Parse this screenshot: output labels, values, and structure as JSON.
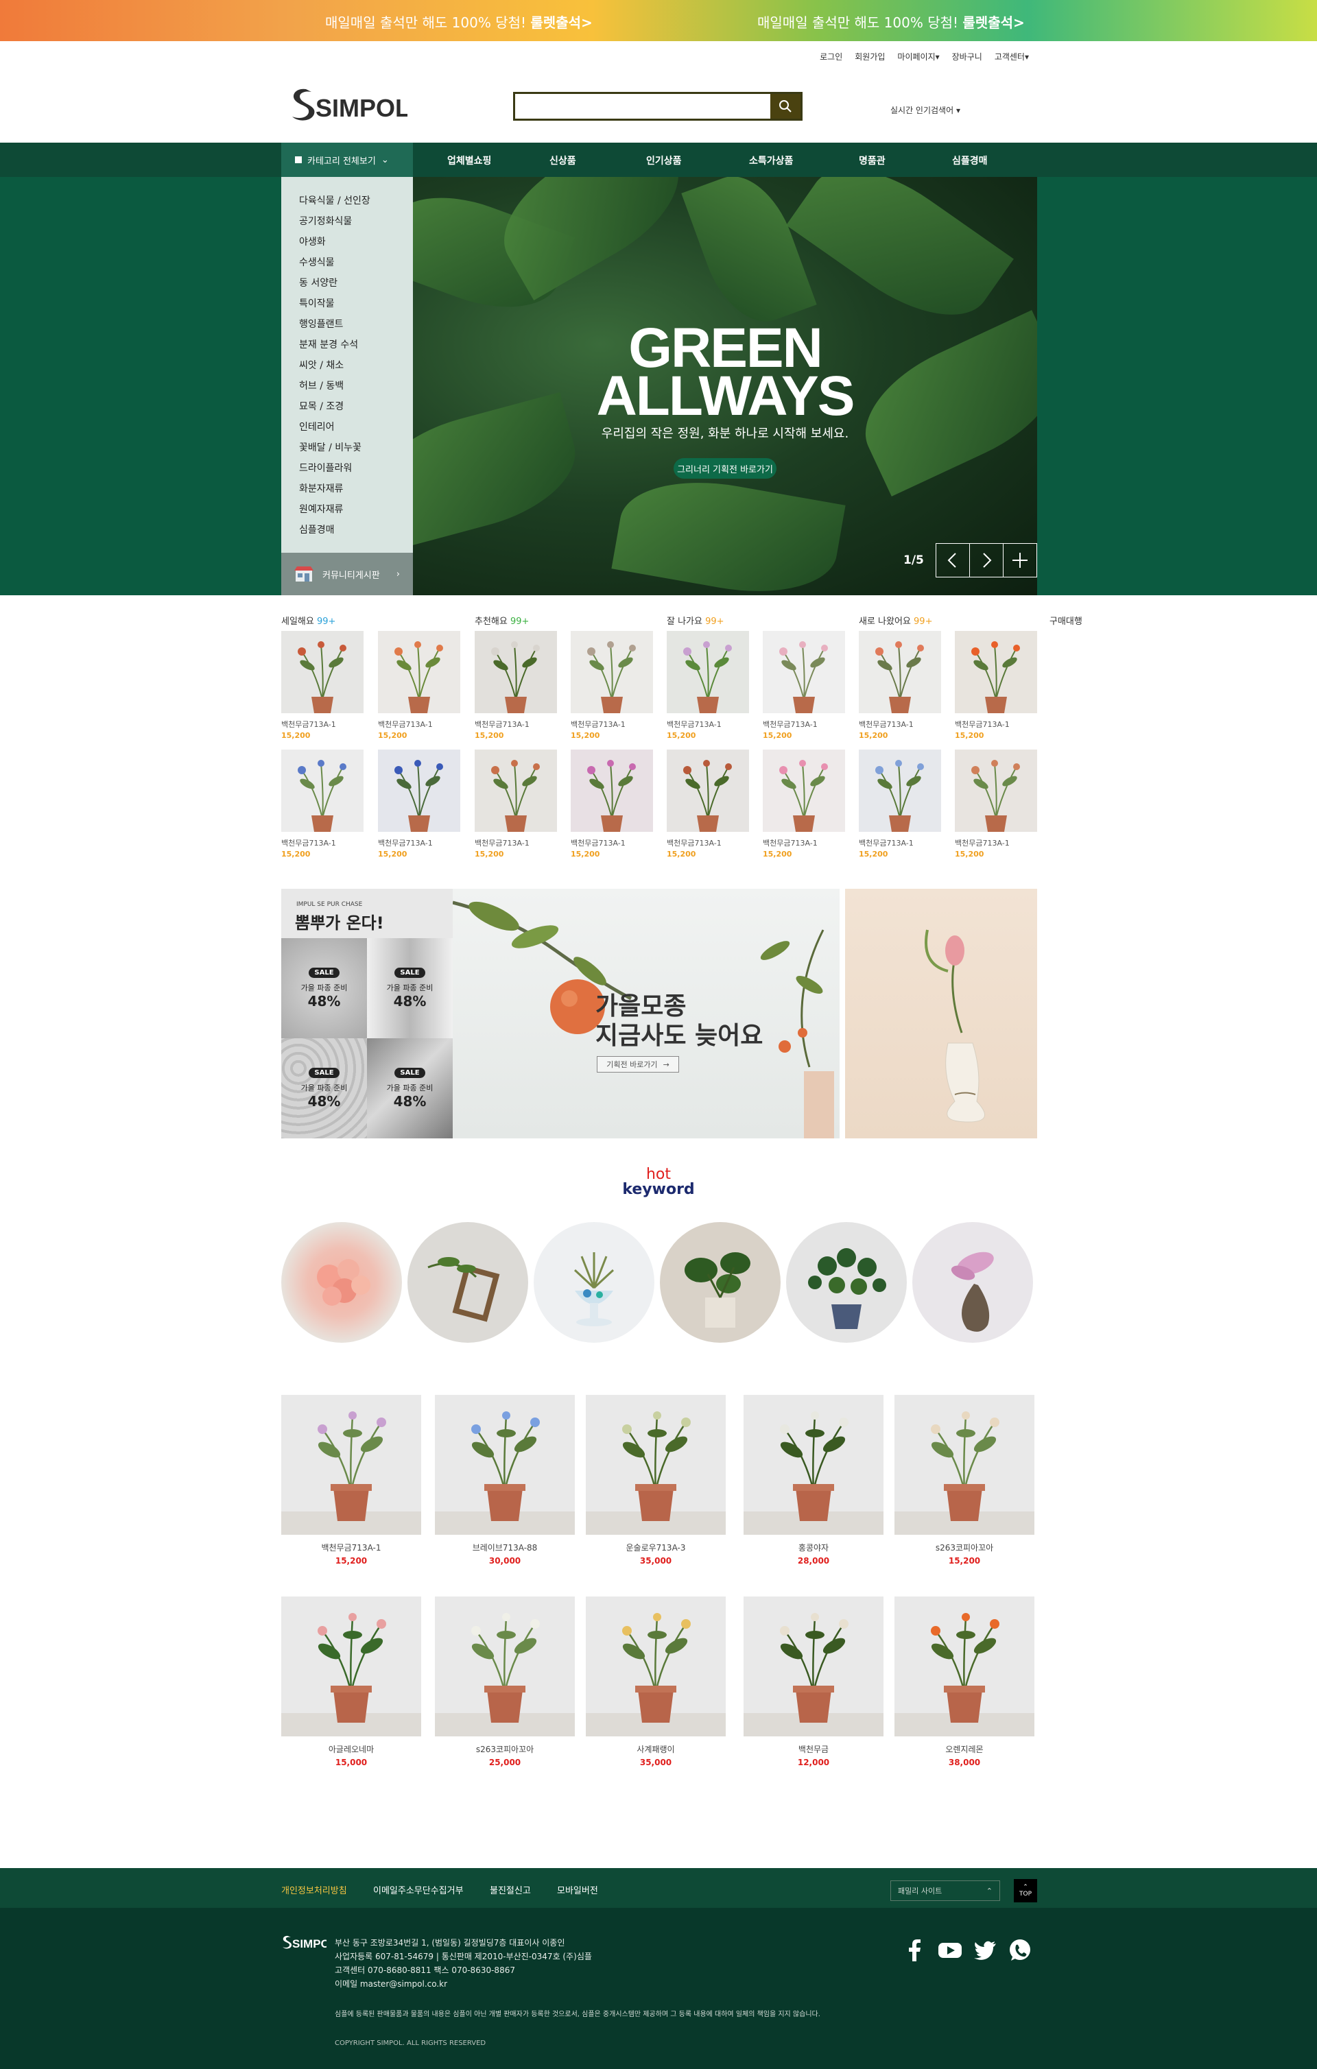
{
  "promo": {
    "msg_left": "매일매일 출석만 해도 100% 당첨! ",
    "msg_left_bold": "룰렛출석>",
    "msg_right": "매일매일 출석만 해도 100% 당첨! ",
    "msg_right_bold": "룰렛출석>"
  },
  "util": [
    "로그인",
    "회원가입",
    "마이페이지▾",
    "장바구니",
    "고객센터▾"
  ],
  "header": {
    "logo_text": "SIMPOL",
    "search_placeholder": "",
    "realtime": "실시간 인기검색어 ▾"
  },
  "nav": {
    "category_all": "카테고리 전체보기",
    "items": [
      "업체별쇼핑",
      "신상품",
      "인기상품",
      "소특가상품",
      "명품관",
      "심플경매"
    ]
  },
  "sidebar": {
    "items": [
      "다육식물 / 선인장",
      "공기정화식물",
      "야생화",
      "수생식물",
      "동 서양란",
      "특이작물",
      "행잉플랜트",
      "분재 분경 수석",
      "씨앗 / 채소",
      "허브 / 동백",
      "묘목 / 조경",
      "인테리어",
      "꽃배달 / 비누꽃",
      "드라이플라워",
      "화분자재류",
      "원예자재류",
      "심플경매"
    ],
    "community": "커뮤니티게시판"
  },
  "hero": {
    "title1": "GREEN",
    "title2": "ALLWAYS",
    "subtitle": "우리집의 작은 정원, 화분 하나로 시작해 보세요.",
    "button": "그리너리 기획전 바로가기",
    "pager": "1/5"
  },
  "sections": [
    {
      "label": "세일해요 ",
      "count": "99+"
    },
    {
      "label": "추천해요 ",
      "count": "99+"
    },
    {
      "label": "잘 나가요 ",
      "count": "99+"
    },
    {
      "label": "새로 나왔어요 ",
      "count": "99+"
    }
  ],
  "buy_agent": "구매대행",
  "grid_products": [
    {
      "name": "백천무금713A-1",
      "price": "15,200"
    },
    {
      "name": "백천무금713A-1",
      "price": "15,200"
    },
    {
      "name": "백천무금713A-1",
      "price": "15,200"
    },
    {
      "name": "백천무금713A-1",
      "price": "15,200"
    },
    {
      "name": "백천무금713A-1",
      "price": "15,200"
    },
    {
      "name": "백천무금713A-1",
      "price": "15,200"
    },
    {
      "name": "백천무금713A-1",
      "price": "15,200"
    },
    {
      "name": "백천무금713A-1",
      "price": "15,200"
    },
    {
      "name": "백천무금713A-1",
      "price": "15,200"
    },
    {
      "name": "백천무금713A-1",
      "price": "15,200"
    },
    {
      "name": "백천무금713A-1",
      "price": "15,200"
    },
    {
      "name": "백천무금713A-1",
      "price": "15,200"
    },
    {
      "name": "백천무금713A-1",
      "price": "15,200"
    },
    {
      "name": "백천무금713A-1",
      "price": "15,200"
    },
    {
      "name": "백천무금713A-1",
      "price": "15,200"
    },
    {
      "name": "백천무금713A-1",
      "price": "15,200"
    }
  ],
  "promo_block": {
    "eng": "IMPUL SE PUR CHASE",
    "title": "뽐뿌가 온다!",
    "tiles": [
      {
        "sale": "SALE",
        "text": "가을 파종 준비",
        "pct": "48%"
      },
      {
        "sale": "SALE",
        "text": "가을 파종 준비",
        "pct": "48%"
      },
      {
        "sale": "SALE",
        "text": "가을 파종 준비",
        "pct": "48%"
      },
      {
        "sale": "SALE",
        "text": "가을 파종 준비",
        "pct": "48%"
      }
    ],
    "banner_line1": "가을모종",
    "banner_line2": "지금사도 늦어요",
    "banner_btn": "기획전 바로가기"
  },
  "hot": {
    "hot": "hot",
    "keyword": "keyword"
  },
  "bottom_products": [
    {
      "name": "백천무금713A-1",
      "price": "15,200"
    },
    {
      "name": "브레이브713A-88",
      "price": "30,000"
    },
    {
      "name": "운술로우713A-3",
      "price": "35,000"
    },
    {
      "name": "홍콩야자",
      "price": "28,000"
    },
    {
      "name": "s263코피아꼬아",
      "price": "15,200"
    },
    {
      "name": "아글레오네마",
      "price": "15,000"
    },
    {
      "name": "s263코피아꼬아",
      "price": "25,000"
    },
    {
      "name": "사계패랭이",
      "price": "35,000"
    },
    {
      "name": "백천무금",
      "price": "12,000"
    },
    {
      "name": "오렌지레몬",
      "price": "38,000"
    }
  ],
  "footer": {
    "links": [
      "개인정보처리방침",
      "이메일주소무단수집거부",
      "불진절신고",
      "모바일버전"
    ],
    "family_site": "패밀리 사이트",
    "top": "TOP",
    "logo_text": "SIMPOL",
    "info": [
      "부산 동구 조방로34번길 1, (범일동) 길정빌딩7층 대표이사 이종인",
      "사업자등록 607-81-54679 | 통신판매 제2010-부산진-0347호 (주)심플",
      "고객센터 070-8680-8811 팩스 070-8630-8867",
      "이메일 master@simpol.co.kr"
    ],
    "notice": "심플에 등록된 판매물품과 물품의 내용은 심플이 아닌 개별 판매자가 등록한 것으로서, 심플은 중개시스템만 제공하며 그 등록 내용에 대하여 일체의 책임을 지지 않습니다.",
    "copyright": "COPYRIGHT SIMPOL. ALL RIGHTS RESERVED"
  },
  "colors": {
    "nav": "#0e4a36",
    "hero": "#0b5a40",
    "footer": "#08382a",
    "price": "#f0a020",
    "red_price": "#e0201e"
  }
}
